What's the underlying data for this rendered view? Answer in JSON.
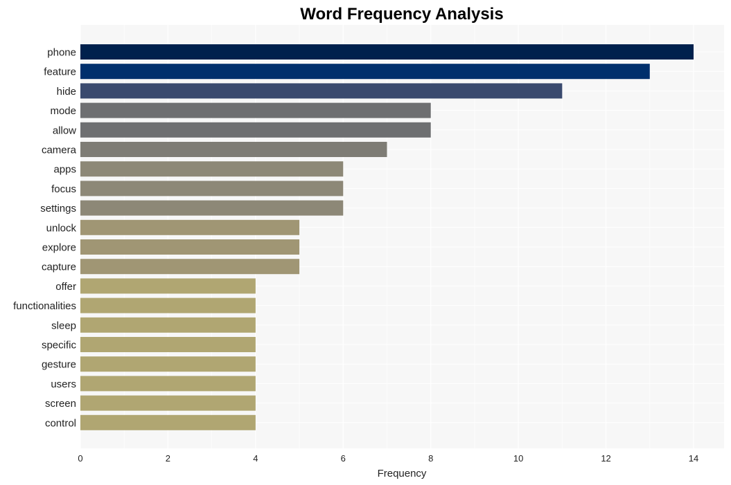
{
  "chart_data": {
    "type": "bar",
    "orientation": "horizontal",
    "title": "Word Frequency Analysis",
    "xlabel": "Frequency",
    "ylabel": "",
    "xlim": [
      0,
      14.7
    ],
    "xticks": [
      0,
      2,
      4,
      6,
      8,
      10,
      12,
      14
    ],
    "grid": true,
    "legend": "none",
    "categories": [
      "phone",
      "feature",
      "hide",
      "mode",
      "allow",
      "camera",
      "apps",
      "focus",
      "settings",
      "unlock",
      "explore",
      "capture",
      "offer",
      "functionalities",
      "sleep",
      "specific",
      "gesture",
      "users",
      "screen",
      "control"
    ],
    "values": [
      14,
      13,
      11,
      8,
      8,
      7,
      6,
      6,
      6,
      5,
      5,
      5,
      4,
      4,
      4,
      4,
      4,
      4,
      4,
      4
    ],
    "colors": [
      "#00214d",
      "#002f6c",
      "#3a4a6e",
      "#6e6f71",
      "#6e6f71",
      "#7e7c75",
      "#8d8877",
      "#8d8877",
      "#8d8877",
      "#a09674",
      "#a09674",
      "#a09674",
      "#b0a672",
      "#b0a672",
      "#b0a672",
      "#b0a672",
      "#b0a672",
      "#b0a672",
      "#b0a672",
      "#b0a672"
    ],
    "plot_background": "#f7f7f7",
    "grid_color": "#ffffff"
  }
}
